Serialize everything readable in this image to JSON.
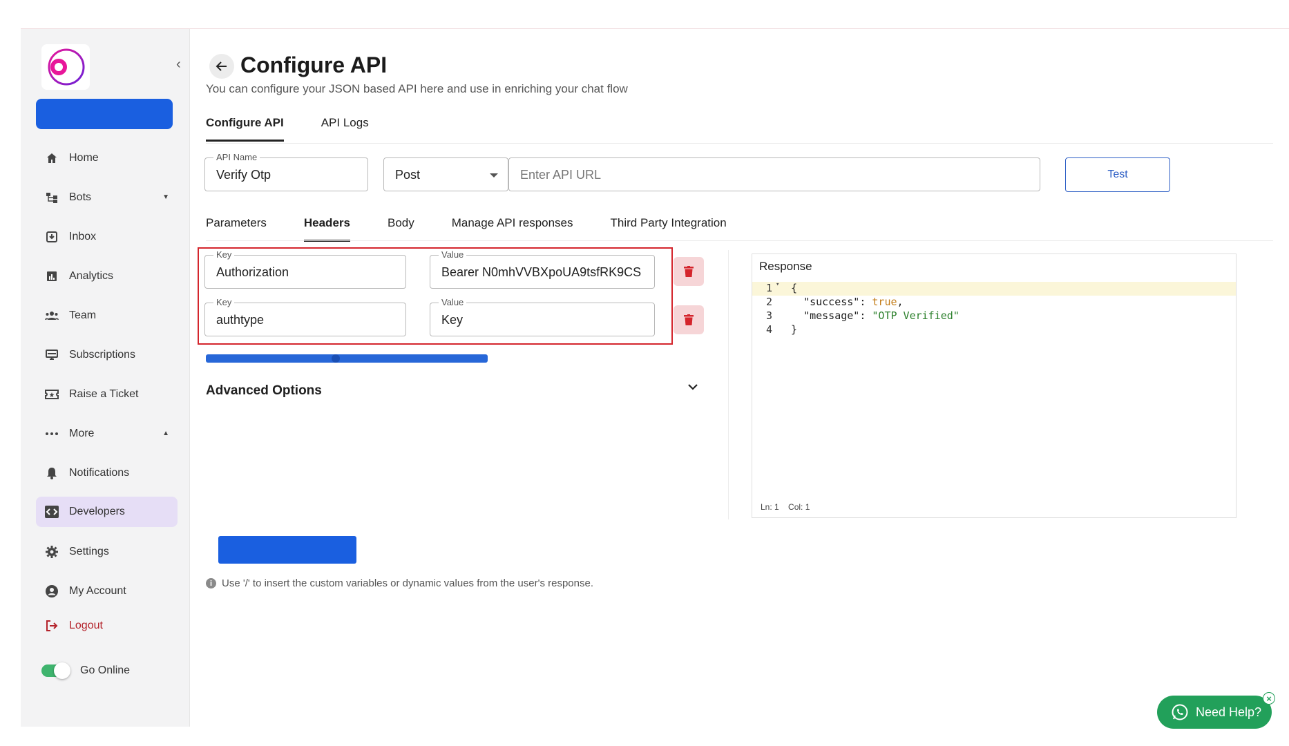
{
  "sidebar": {
    "items": [
      {
        "label": "Home",
        "icon": "home-icon"
      },
      {
        "label": "Bots",
        "icon": "bots-icon"
      },
      {
        "label": "Inbox",
        "icon": "inbox-icon"
      },
      {
        "label": "Analytics",
        "icon": "analytics-icon"
      },
      {
        "label": "Team",
        "icon": "team-icon"
      },
      {
        "label": "Subscriptions",
        "icon": "subscriptions-icon"
      },
      {
        "label": "Raise a Ticket",
        "icon": "ticket-icon"
      },
      {
        "label": "More",
        "icon": "more-icon"
      },
      {
        "label": "Notifications",
        "icon": "bell-icon"
      },
      {
        "label": "Developers",
        "icon": "code-icon"
      },
      {
        "label": "Settings",
        "icon": "gear-icon"
      },
      {
        "label": "My Account",
        "icon": "account-icon"
      },
      {
        "label": "Logout",
        "icon": "logout-icon"
      }
    ],
    "go_online_label": "Go Online",
    "go_online": true
  },
  "header": {
    "title": "Configure API",
    "subtitle": "You can configure your JSON based API here and use in enriching your chat flow"
  },
  "tabs": [
    "Configure API",
    "API Logs"
  ],
  "form": {
    "api_name_label": "API Name",
    "api_name_value": "Verify Otp",
    "method_value": "Post",
    "url_placeholder": "Enter API URL",
    "test_label": "Test"
  },
  "subtabs": [
    "Parameters",
    "Headers",
    "Body",
    "Manage API responses",
    "Third Party Integration"
  ],
  "headers": [
    {
      "key_label": "Key",
      "key": "Authorization",
      "value_label": "Value",
      "value": "Bearer N0mhVVBXpoUA9tsfRK9CS"
    },
    {
      "key_label": "Key",
      "key": "authtype",
      "value_label": "Value",
      "value": "Key"
    }
  ],
  "advanced_options_label": "Advanced Options",
  "response": {
    "title": "Response",
    "line_numbers": [
      "1",
      "2",
      "3",
      "4"
    ],
    "line1": "{",
    "success_key": "\"success\"",
    "success_val": "true",
    "message_key": "\"message\"",
    "message_val": "\"OTP Verified\"",
    "line4": "}",
    "status_ln": "Ln: 1",
    "status_col": "Col: 1"
  },
  "hint": "Use '/' to insert the custom variables or dynamic values from the user's response.",
  "help_label": "Need Help?",
  "colors": {
    "primary": "#1a5fe0",
    "danger": "#d4252c",
    "whatsapp": "#22a05a"
  }
}
